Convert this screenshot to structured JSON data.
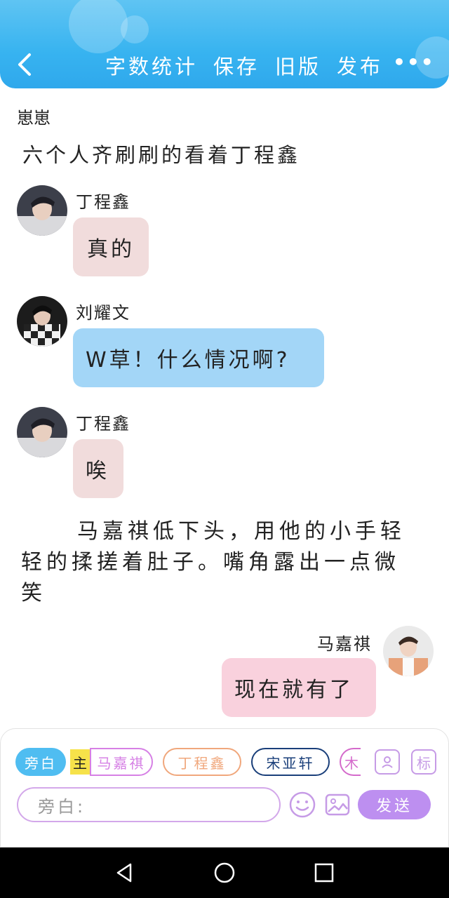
{
  "header": {
    "actions": [
      "字数统计",
      "保存",
      "旧版",
      "发布"
    ],
    "more": "•••"
  },
  "narration_top": {
    "name": "崽崽",
    "text": "六个人齐刷刷的看着丁程鑫"
  },
  "messages": [
    {
      "sender": "丁程鑫",
      "text": "真的",
      "side": "left",
      "bubble_color": "#f1dcdc"
    },
    {
      "sender": "刘耀文",
      "text": "W草！什么情况啊?",
      "side": "left",
      "bubble_color": "#a3d6f7"
    },
    {
      "sender": "丁程鑫",
      "text": "唉",
      "side": "left",
      "bubble_color": "#f1dcdc"
    },
    {
      "sender": "马嘉祺",
      "text": "现在就有了",
      "side": "right",
      "bubble_color": "#f9d1dd"
    }
  ],
  "narration_mid": "马嘉祺低下头，用他的小手轻轻的揉搓着肚子。嘴角露出一点微笑",
  "composer": {
    "chips": [
      "旁白",
      "马嘉祺",
      "丁程鑫",
      "宋亚轩",
      "木"
    ],
    "host_tag": "主",
    "mark_button": "标",
    "input_placeholder": "旁白:",
    "send_label": "发送"
  },
  "colors": {
    "header_blue": "#37b3f0",
    "accent_purple": "#bd8ff0",
    "chip_narration": "#4fbdf1"
  }
}
